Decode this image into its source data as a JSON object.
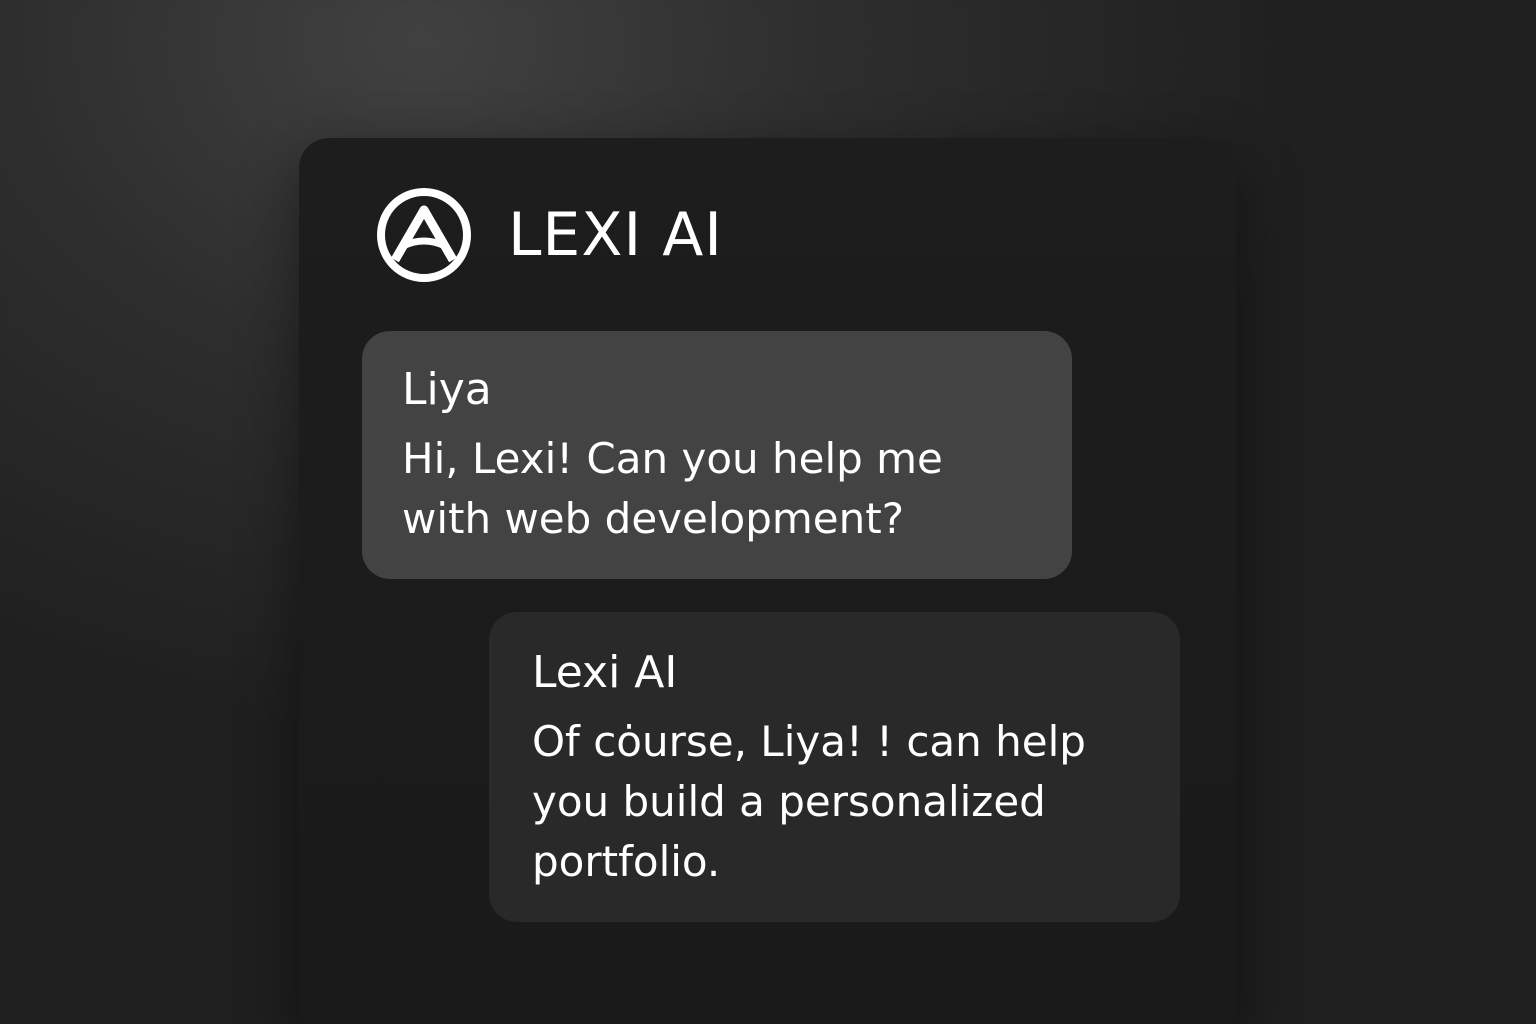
{
  "app": {
    "title": "LEXI AI",
    "logo_icon": "lexi-logo-icon"
  },
  "colors": {
    "panel": "#1c1c1c",
    "user_bubble": "#434343",
    "ai_bubble": "#292929",
    "text": "#ffffff"
  },
  "chat": {
    "messages": [
      {
        "sender": "Liya",
        "text": "Hi, Lexi! Can you help me with web development?"
      },
      {
        "sender": "Lexi AI",
        "text": "Of cȯurse, Liya! ! can help you build a personalized portfolio."
      }
    ]
  }
}
